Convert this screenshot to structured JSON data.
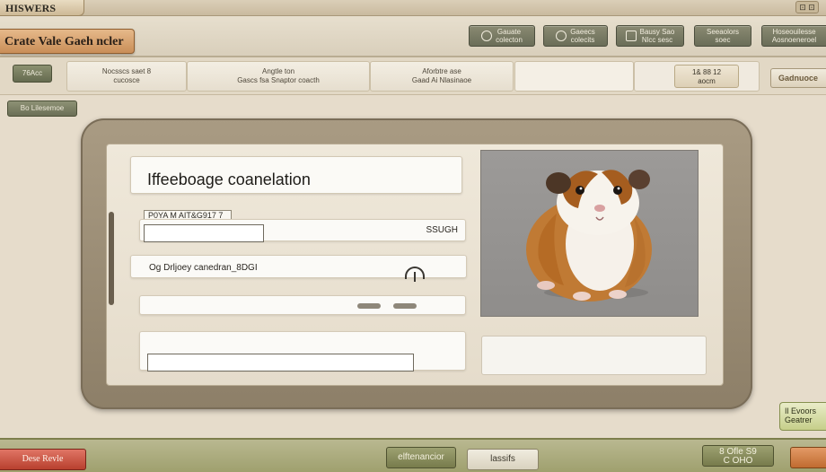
{
  "window": {
    "brand_tab": "HISWERS",
    "corner_chip": "⊡ ⊡"
  },
  "header": {
    "title": "Crate Vale Gaeh ncler",
    "nav": [
      {
        "label": "Gauate\ncolecton",
        "icon": "circle-icon"
      },
      {
        "label": "Gaeecs\ncolecits",
        "icon": "circle-icon"
      },
      {
        "label": "Bausy Sao\nNlcc sesc",
        "icon": "square-icon"
      },
      {
        "label": "Seeaolors\nsoec",
        "icon": "square-icon"
      },
      {
        "label": "Hoseouilesse\nAosnoeneroel",
        "icon": "square-icon"
      }
    ]
  },
  "filters": {
    "toggle_label": "76Acc",
    "fields": [
      {
        "line1": "Nocsscs  saet    8",
        "line2": "cucosce"
      },
      {
        "line1": "Angtle ton",
        "line2": "Gascs fsa Snaptor coacth"
      },
      {
        "line1": "Aforbtre ase",
        "line2": "Gaad Ai Nlasinaoe"
      }
    ],
    "chip": {
      "line1": "1& 88  12",
      "line2": "aocm"
    },
    "side_button": "Gadnuoce"
  },
  "secondary": {
    "tag_label": "Bo Lilesemoe"
  },
  "form": {
    "title": "Iffeeboage coanelation",
    "field_label": "P0YA M AIT&G917 7",
    "row1_value": "SSUGH",
    "row2_text": "Og Drljoey canedran_8DGI",
    "preview_icon": "guinea-pig-image"
  },
  "side_note": {
    "line1": "Il Evoors",
    "line2": "Geatrer"
  },
  "footer": {
    "left_button": "Dese Revle",
    "center_button": "elftenancior",
    "center_right_button": "lassifs",
    "right_button": "8 Ofle S9\nC OHO",
    "far_right_button": ""
  }
}
